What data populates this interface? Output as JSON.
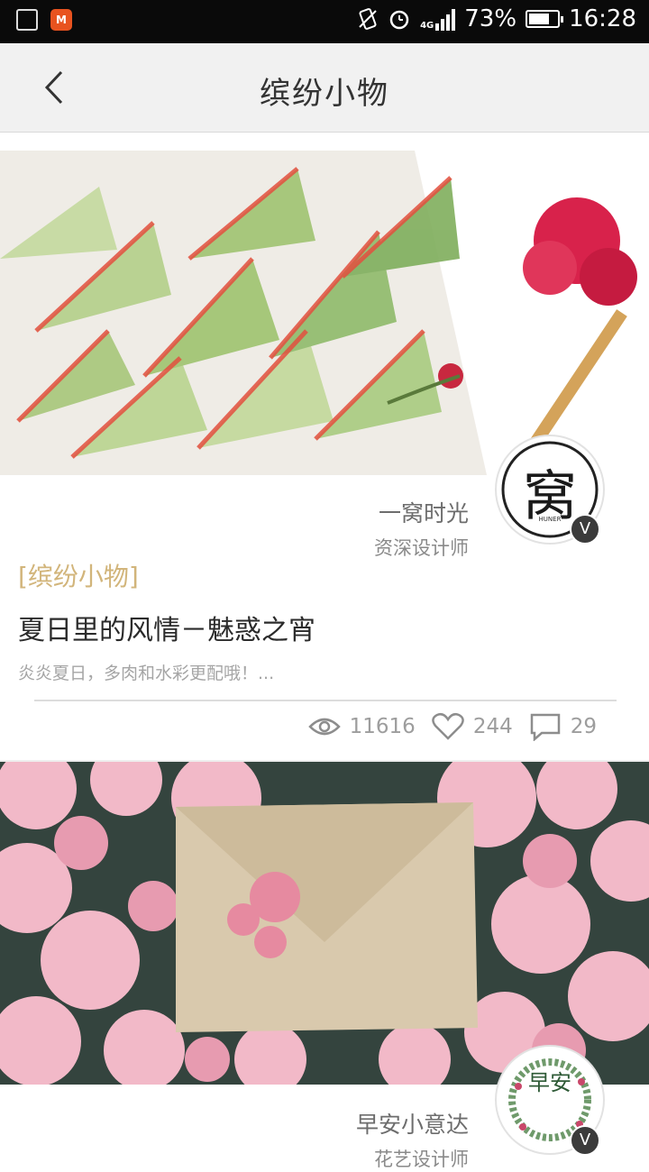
{
  "status_bar": {
    "battery_percent": "73%",
    "time": "16:28",
    "network": "4G",
    "battery_level": 0.73
  },
  "header": {
    "title": "缤纷小物"
  },
  "posts": [
    {
      "author_name": "一窝时光",
      "author_role": "资深设计师",
      "avatar_text": "窝",
      "avatar_subtext": "HUNER",
      "verified": "V",
      "category": "[缤纷小物]",
      "title": "夏日里的风情－魅惑之宵",
      "excerpt": "炎炎夏日，多肉和水彩更配哦！...",
      "views": "11616",
      "likes": "244",
      "comments": "29"
    },
    {
      "author_name": "早安小意达",
      "author_role": "花艺设计师",
      "avatar_text": "早安",
      "verified": "V"
    }
  ]
}
